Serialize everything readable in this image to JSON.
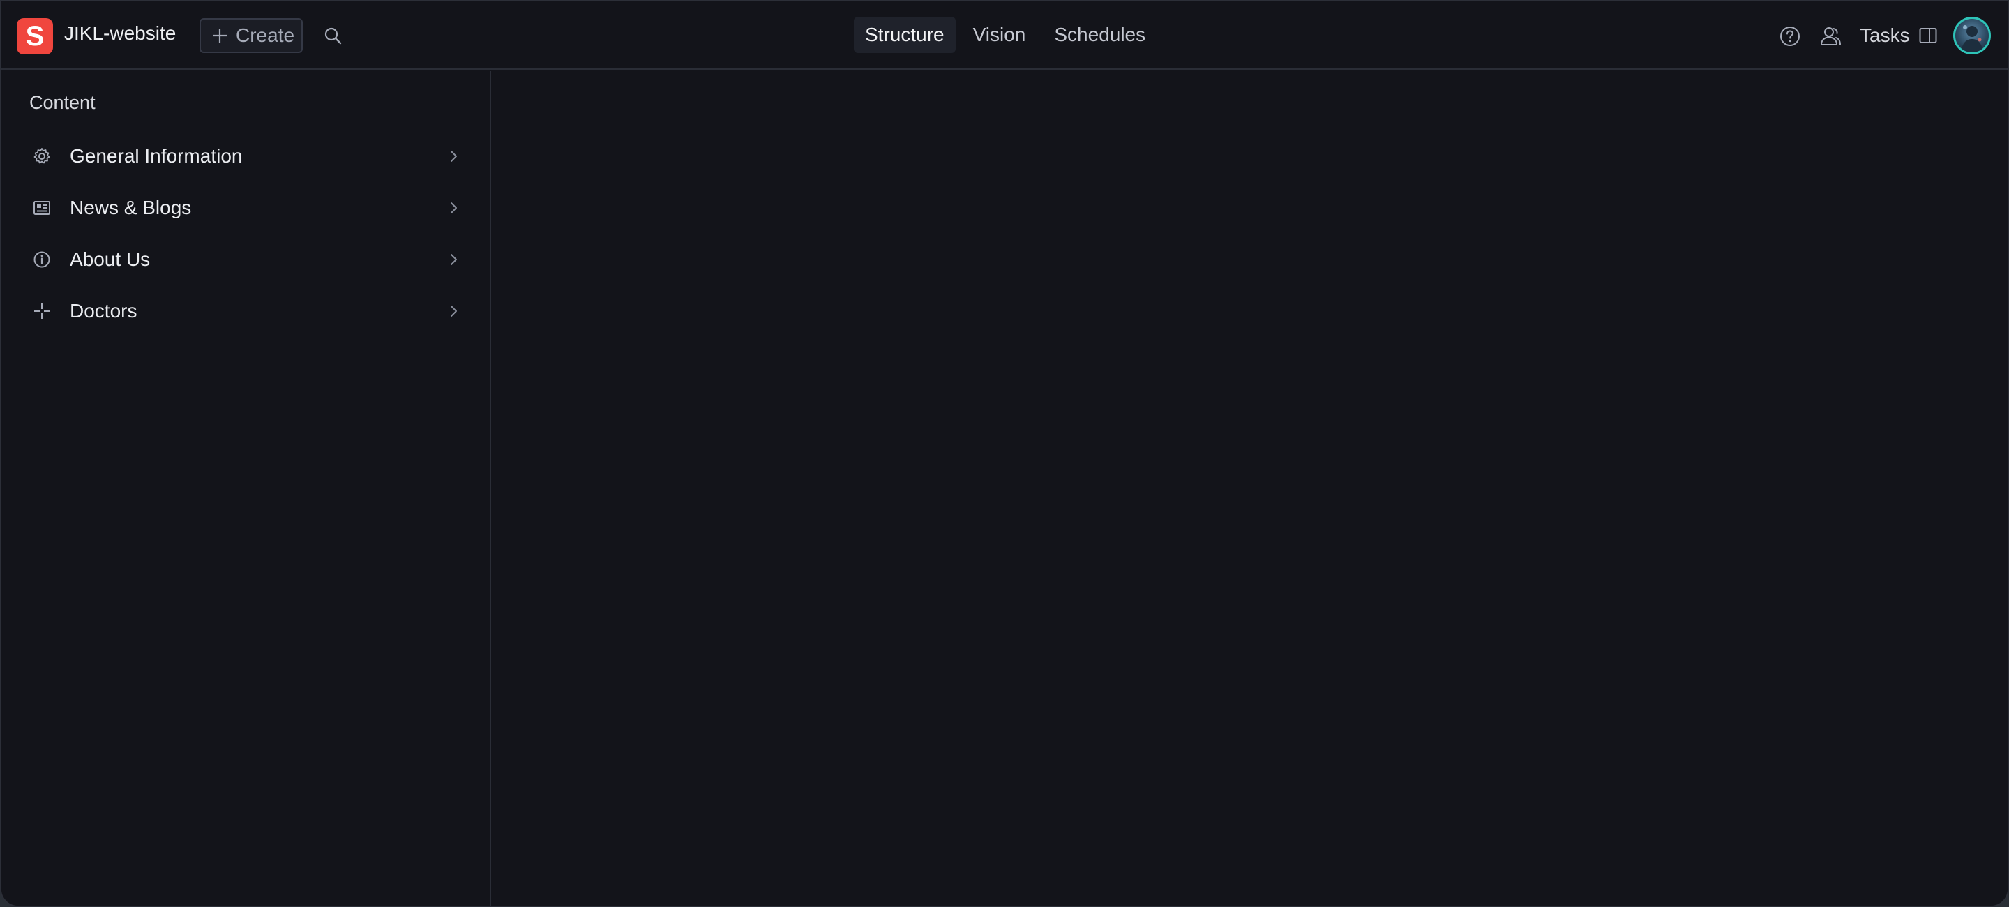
{
  "header": {
    "logo_letter": "S",
    "workspace_name": "JIKL-website",
    "create_label": "Create",
    "nav_tabs": [
      {
        "label": "Structure",
        "active": true
      },
      {
        "label": "Vision",
        "active": false
      },
      {
        "label": "Schedules",
        "active": false
      }
    ],
    "tasks_label": "Tasks"
  },
  "sidebar": {
    "title": "Content",
    "items": [
      {
        "label": "General Information",
        "icon": "gear-icon"
      },
      {
        "label": "News & Blogs",
        "icon": "newspaper-icon"
      },
      {
        "label": "About Us",
        "icon": "info-icon"
      },
      {
        "label": "Doctors",
        "icon": "crosshair-icon"
      }
    ]
  },
  "colors": {
    "background": "#13141a",
    "logo_accent": "#f0463e",
    "avatar_ring": "#2ec4b8",
    "active_tab_bg": "#1f222b"
  }
}
